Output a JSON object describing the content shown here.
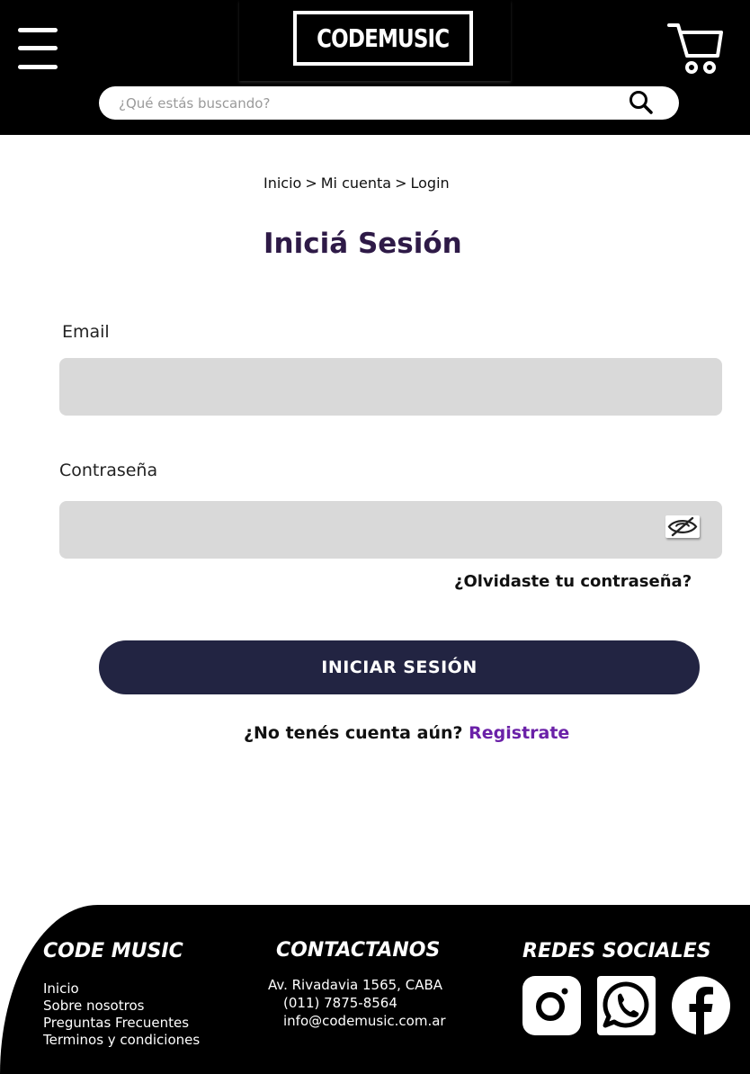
{
  "header": {
    "logo_text": "CODEMUSIC",
    "search_placeholder": "¿Qué estás buscando?",
    "icons": [
      "menu-icon",
      "cart-icon",
      "search-icon"
    ]
  },
  "breadcrumb": {
    "items": [
      "Inicio",
      "Mi cuenta",
      "Login"
    ],
    "separator": ">"
  },
  "page_title": "Iniciá Sesión",
  "form": {
    "email_label": "Email",
    "email_value": "",
    "password_label": "Contraseña",
    "password_value": "",
    "forgot_label": "¿Olvidaste tu contraseña?",
    "submit_label": "INICIAR SESIÓN",
    "register_prompt": "¿No tenés cuenta aún?",
    "register_link": "Registrate"
  },
  "footer": {
    "col1_title": "CODE MUSIC",
    "links": [
      "Inicio",
      "Sobre nosotros",
      "Preguntas Frecuentes",
      "Terminos y condiciones"
    ],
    "col2_title": "CONTACTANOS",
    "address": "Av. Rivadavia 1565, CABA",
    "phone": "(011) 7875-8564",
    "email": "info@codemusic.com.ar",
    "col3_title": "REDES SOCIALES",
    "social_icons": [
      "instagram-icon",
      "whatsapp-icon",
      "facebook-icon"
    ]
  },
  "colors": {
    "header_bg": "#000000",
    "title": "#2e1a47",
    "button_bg": "#222442",
    "link_accent": "#6b21a8",
    "field_bg": "#d9d9d9"
  }
}
